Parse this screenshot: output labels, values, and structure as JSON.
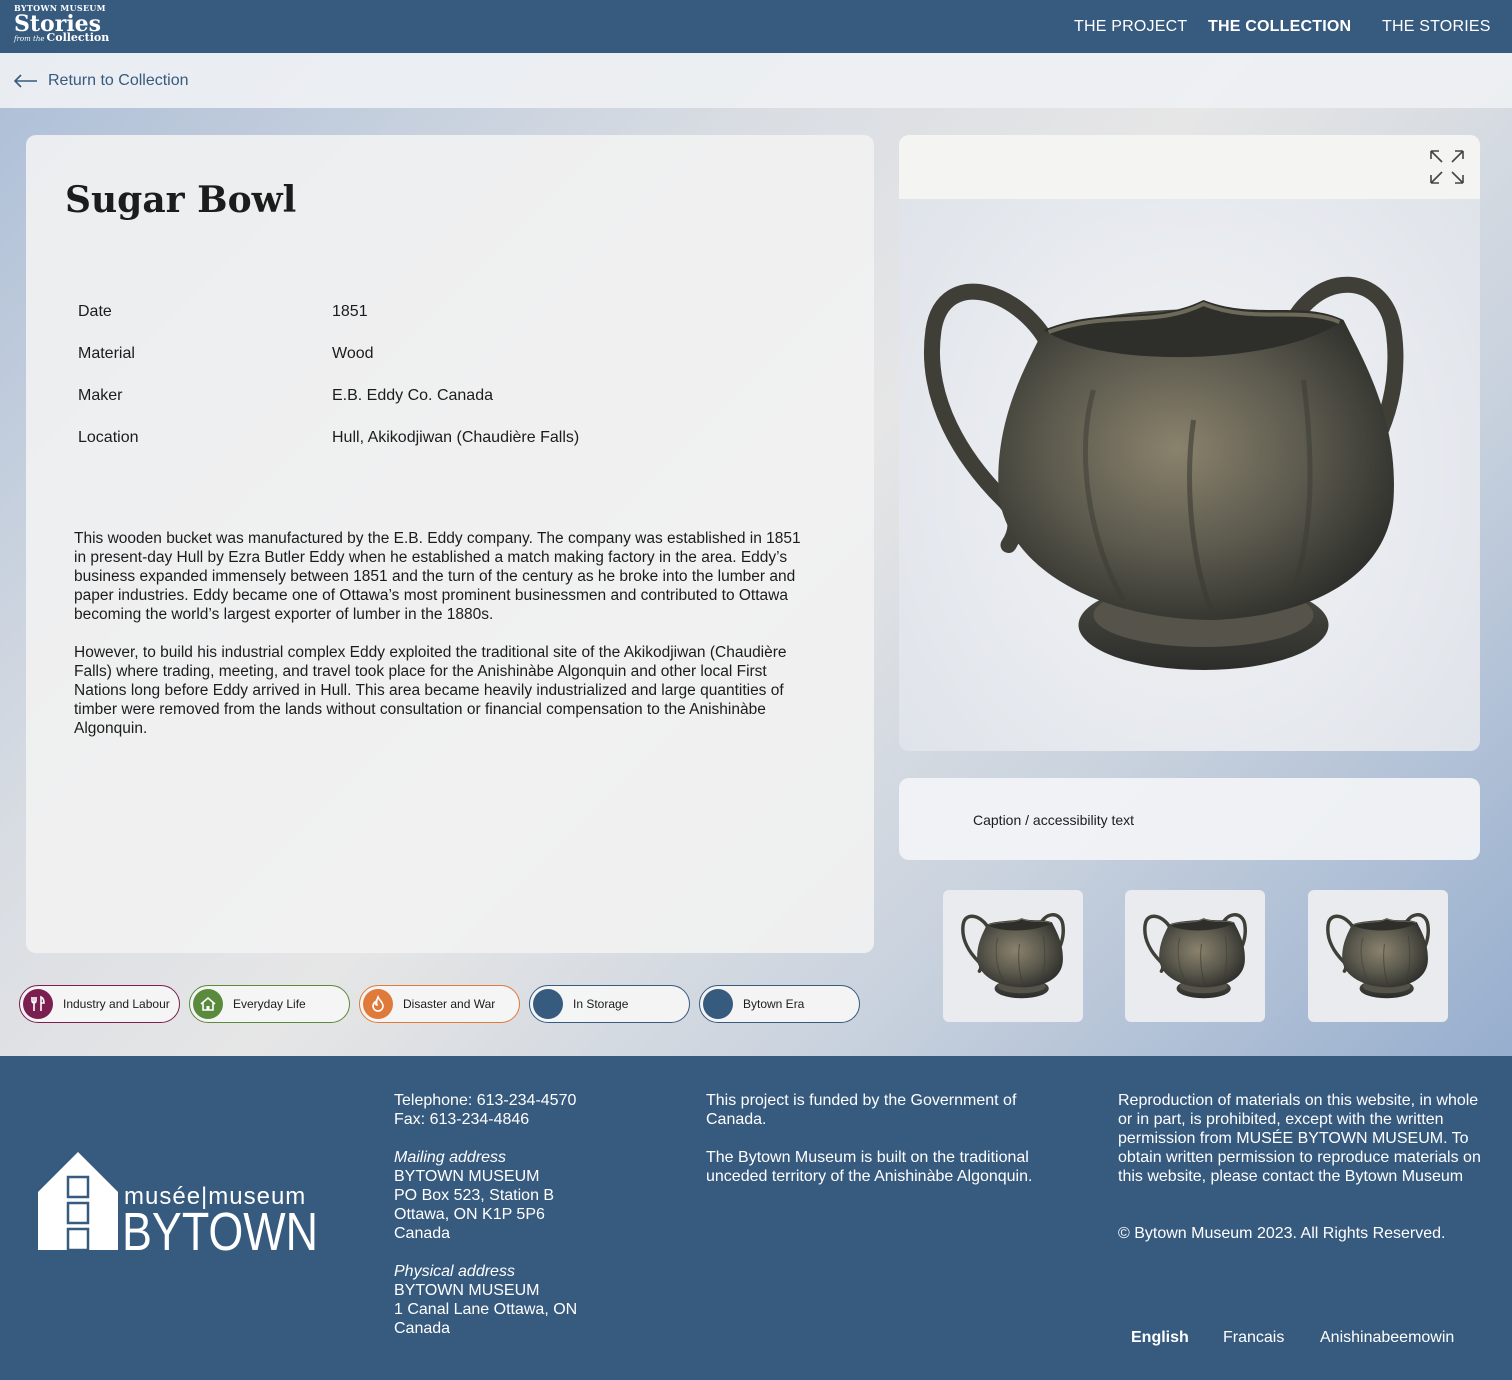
{
  "header": {
    "logo": {
      "line1": "BYTOWN MUSEUM",
      "line2": "Stories",
      "line3_small": "from the",
      "line3": "Collection"
    },
    "nav": [
      {
        "label": "THE PROJECT"
      },
      {
        "label": "THE COLLECTION"
      },
      {
        "label": "THE STORIES"
      }
    ]
  },
  "back_link": "Return to Collection",
  "artifact": {
    "title": "Sugar Bowl",
    "meta": [
      {
        "key": "Date",
        "value": "1851"
      },
      {
        "key": "Material",
        "value": "Wood"
      },
      {
        "key": "Maker",
        "value": "E.B. Eddy Co. Canada"
      },
      {
        "key": "Location",
        "value": "Hull, Akikodjiwan (Chaudière Falls)"
      }
    ],
    "description": [
      "This wooden bucket was manufactured by the E.B. Eddy company. The company was established in 1851 in present-day Hull by Ezra Butler Eddy when he established a match making factory in the area. Eddy’s business expanded immensely between 1851 and the turn of the century as he broke into the lumber and paper industries. Eddy became one of Ottawa’s most prominent businessmen and contributed to Ottawa becoming the world’s largest exporter of lumber in the 1880s.",
      "However, to build his industrial complex Eddy exploited the traditional site of the Akikodjiwan (Chaudière Falls) where trading, meeting, and travel took place for the Anishinàbe Algonquin and other local First Nations long before Eddy arrived in Hull. This area became heavily industrialized and large quantities of timber were removed from the lands without consultation or financial compensation to the Anishinàbe Algonquin."
    ],
    "caption": "Caption / accessibility text"
  },
  "tags": [
    {
      "label": "Industry and Labour",
      "color": "#7a1f4f",
      "icon": "tools-icon"
    },
    {
      "label": "Everyday Life",
      "color": "#5a8a3c",
      "icon": "house-icon"
    },
    {
      "label": "Disaster and War",
      "color": "#e07a3a",
      "icon": "fire-icon"
    },
    {
      "label": "In Storage",
      "color": "#375a7f",
      "icon": "dot-icon"
    },
    {
      "label": "Bytown Era",
      "color": "#375a7f",
      "icon": "dot-icon"
    }
  ],
  "footer": {
    "logo": {
      "top": "musée|museum",
      "bottom": "BYTOWN"
    },
    "contact": {
      "phone": "Telephone: 613-234-4570",
      "fax": "Fax: 613-234-4846",
      "mailing_label": "Mailing address",
      "mailing": [
        "BYTOWN MUSEUM",
        "PO Box 523, Station B",
        "Ottawa, ON K1P 5P6",
        "Canada"
      ],
      "physical_label": "Physical address",
      "physical": [
        "BYTOWN MUSEUM",
        "1 Canal Lane Ottawa, ON",
        "Canada"
      ]
    },
    "funding": "This project is funded by the Government of Canada.",
    "territory": "The Bytown Museum is built on the traditional unceded territory of the Anishinàbe Algonquin.",
    "rights": "Reproduction of materials on this website, in whole or in part, is prohibited, except with the written permission from MUSÉE BYTOWN MUSEUM. To obtain written permission to reproduce materials on this website, please contact the Bytown Museum",
    "copyright": "© Bytown Museum 2023. All Rights Reserved.",
    "languages": [
      {
        "label": "English"
      },
      {
        "label": "Francais"
      },
      {
        "label": "Anishinabeemowin"
      }
    ]
  },
  "colors": {
    "brand": "#375a7f",
    "panel": "#f2f2f2"
  }
}
